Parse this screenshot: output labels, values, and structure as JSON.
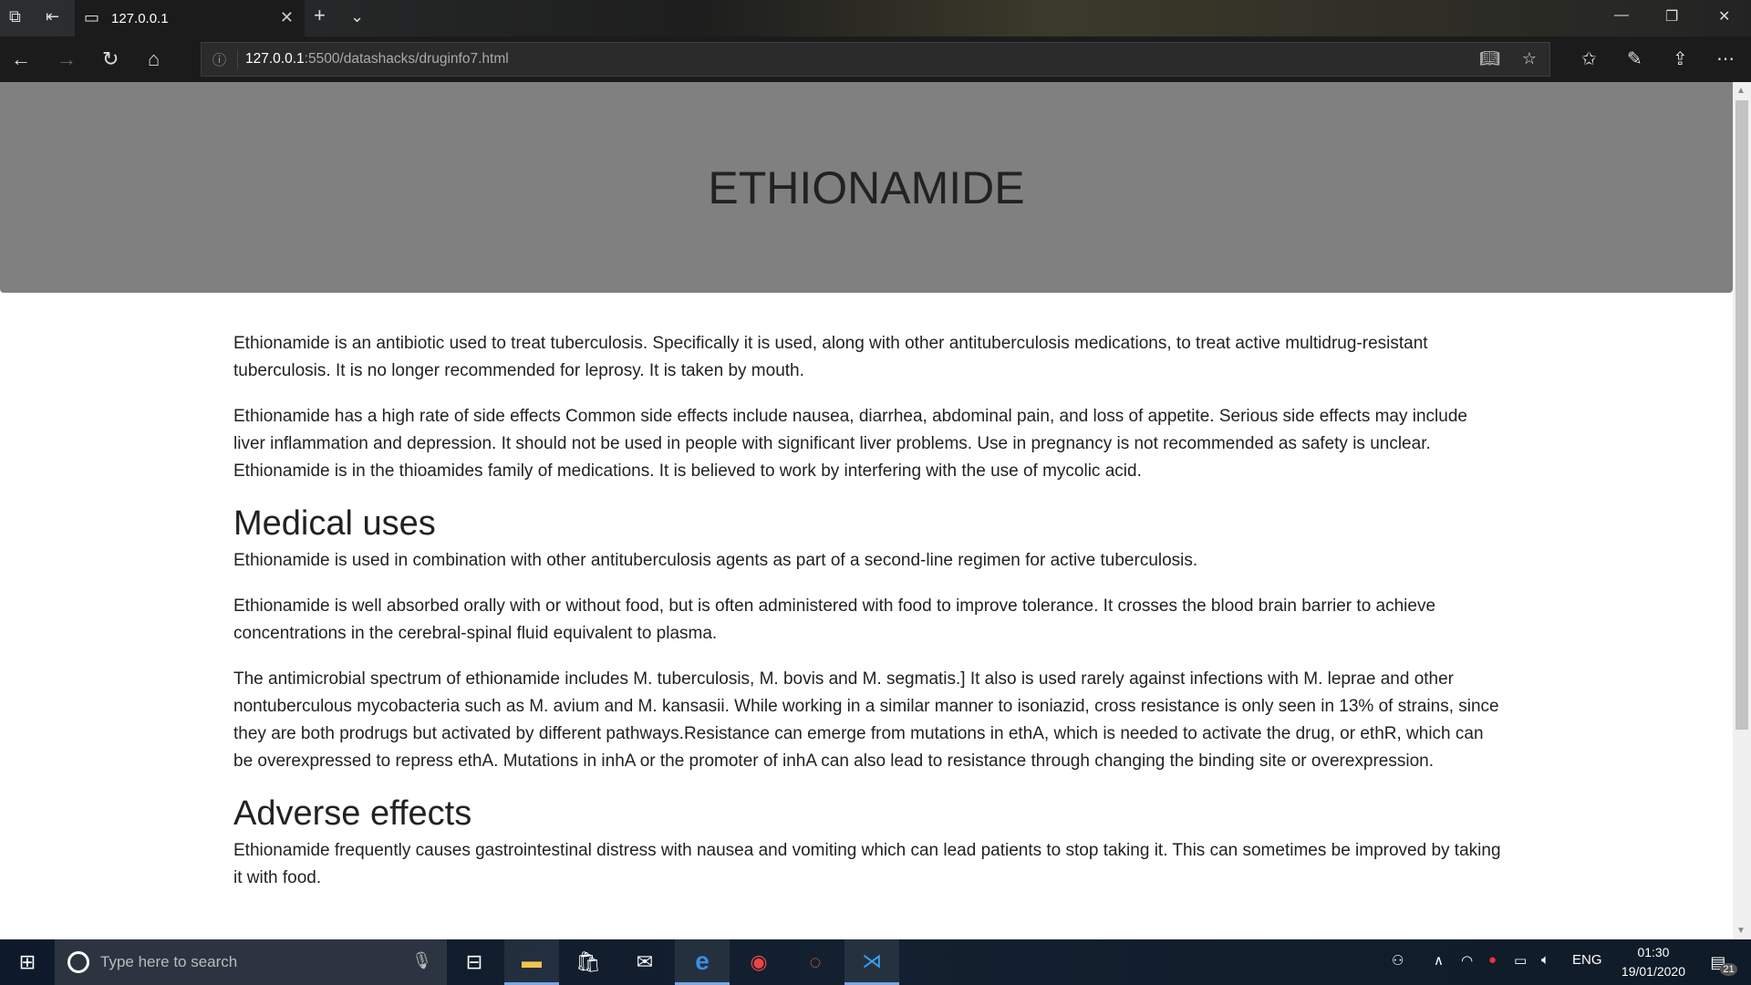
{
  "browser": {
    "tab_title": "127.0.0.1",
    "url_host": "127.0.0.1",
    "url_path": ":5500/datashacks/druginfo7.html",
    "icons": [
      "tab-sets-icon",
      "set-aside-icon",
      "page-icon",
      "close-icon",
      "new-tab-icon",
      "chevron-down-icon",
      "minimize-icon",
      "restore-icon",
      "close-window-icon",
      "back-icon",
      "forward-icon",
      "refresh-icon",
      "home-icon",
      "info-icon",
      "reading-view-icon",
      "favorite-star-icon",
      "favorites-icon",
      "pen-icon",
      "share-icon",
      "more-icon"
    ]
  },
  "page": {
    "title": "ETHIONAMIDE",
    "intro": [
      "Ethionamide is an antibiotic used to treat tuberculosis. Specifically it is used, along with other antituberculosis medications, to treat active multidrug-resistant tuberculosis. It is no longer recommended for leprosy. It is taken by mouth.",
      "Ethionamide has a high rate of side effects Common side effects include nausea, diarrhea, abdominal pain, and loss of appetite. Serious side effects may include liver inflammation and depression. It should not be used in people with significant liver problems. Use in pregnancy is not recommended as safety is unclear. Ethionamide is in the thioamides family of medications. It is believed to work by interfering with the use of mycolic acid."
    ],
    "sections": [
      {
        "heading": "Medical uses",
        "paragraphs": [
          "Ethionamide is used in combination with other antituberculosis agents as part of a second-line regimen for active tuberculosis.",
          "Ethionamide is well absorbed orally with or without food, but is often administered with food to improve tolerance. It crosses the blood brain barrier to achieve concentrations in the cerebral-spinal fluid equivalent to plasma.",
          "The antimicrobial spectrum of ethionamide includes M. tuberculosis, M. bovis and M. segmatis.] It also is used rarely against infections with M. leprae and other nontuberculous mycobacteria such as M. avium and M. kansasii. While working in a similar manner to isoniazid, cross resistance is only seen in 13% of strains, since they are both prodrugs but activated by different pathways.Resistance can emerge from mutations in ethA, which is needed to activate the drug, or ethR, which can be overexpressed to repress ethA. Mutations in inhA or the promoter of inhA can also lead to resistance through changing the binding site or overexpression."
        ]
      },
      {
        "heading": "Adverse effects",
        "paragraphs": [
          "Ethionamide frequently causes gastrointestinal distress with nausea and vomiting which can lead patients to stop taking it. This can sometimes be improved by taking it with food."
        ]
      }
    ]
  },
  "taskbar": {
    "search_placeholder": "Type here to search",
    "language": "ENG",
    "time": "01:30",
    "date": "19/01/2020",
    "notification_count": "21"
  }
}
